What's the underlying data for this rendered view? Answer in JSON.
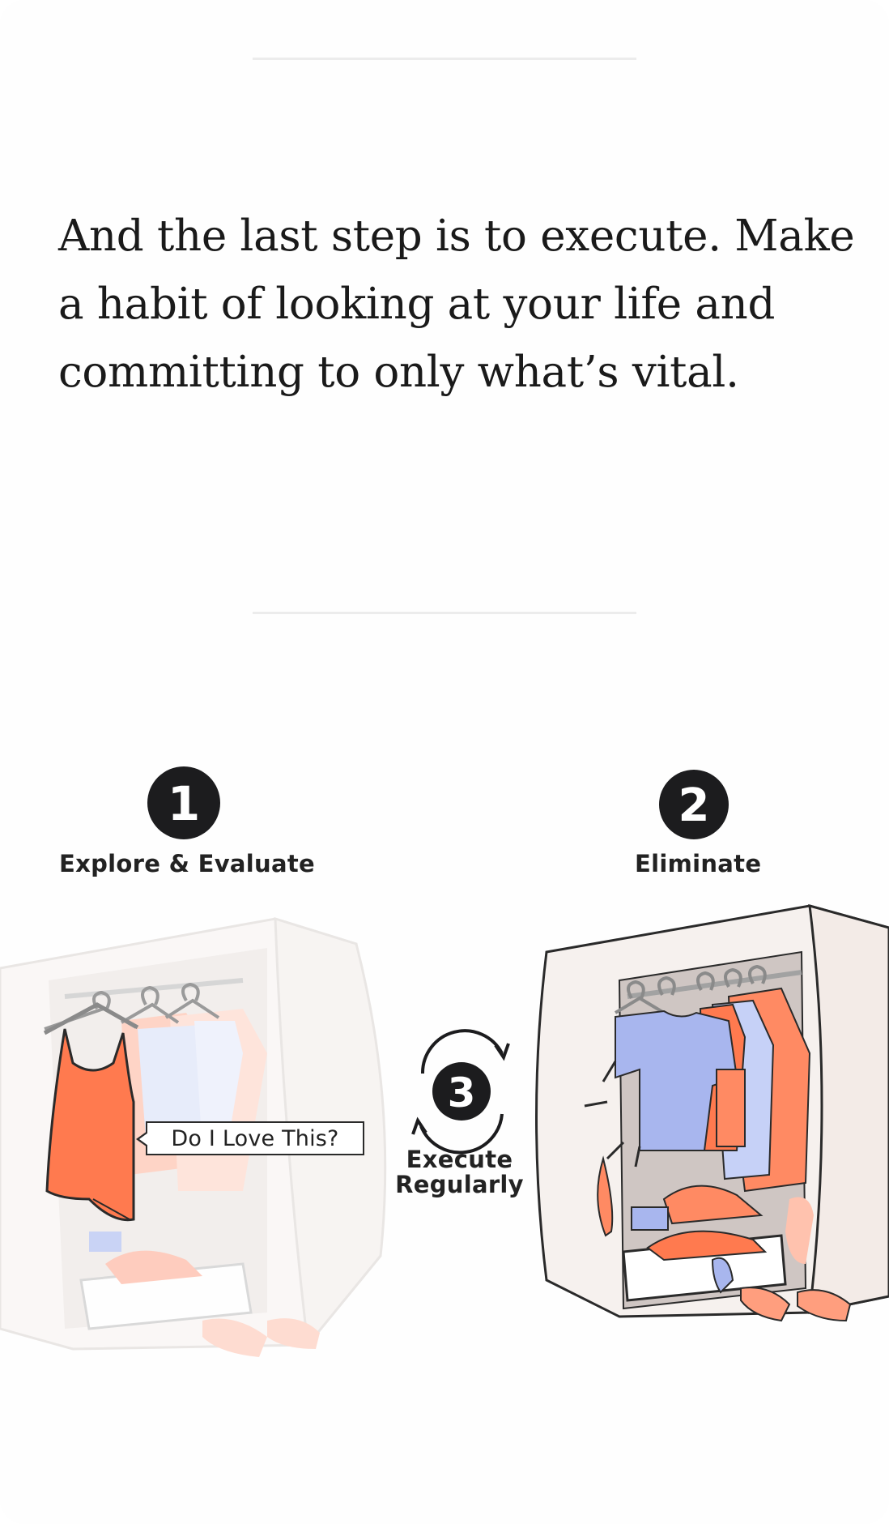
{
  "body_text": "And the last step is to execute. Make a habit of looking at your life and committing to only what’s vital.",
  "steps": [
    {
      "number": "1",
      "label": "Explore & Evaluate"
    },
    {
      "number": "2",
      "label": "Eliminate"
    },
    {
      "number": "3",
      "label": "Execute Regularly"
    }
  ],
  "tooltip": "Do I Love This?",
  "colors": {
    "accent_orange": "#ff7a4f",
    "accent_blue": "#a8b6ee",
    "circle_dark": "#1c1c1e",
    "closet_fill": "#f6f1ee",
    "divider": "#ececec"
  }
}
